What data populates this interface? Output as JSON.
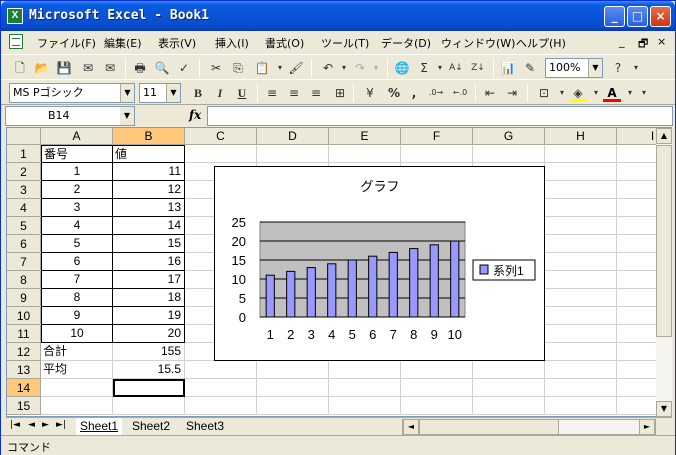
{
  "window": {
    "title": "Microsoft Excel - Book1",
    "app_icon_letter": "X"
  },
  "window_controls": {
    "minimize": "_",
    "maximize": "□",
    "close": "×"
  },
  "menu": [
    "ファイル(F)",
    "編集(E)",
    "表示(V)",
    "挿入(I)",
    "書式(O)",
    "ツール(T)",
    "データ(D)",
    "ウィンドウ(W)",
    "ヘルプ(H)"
  ],
  "doc_controls": {
    "minimize": "_",
    "restore": "🗗",
    "close": "×"
  },
  "toolbar": {
    "zoom": "100%",
    "font_name": "MS Pゴシック",
    "font_size": "11",
    "bold": "B",
    "italic": "I",
    "underline": "U",
    "percent": "%",
    "comma": ","
  },
  "formula_bar": {
    "name_box": "B14",
    "fx": "fx",
    "formula": ""
  },
  "columns": [
    "A",
    "B",
    "C",
    "D",
    "E",
    "F",
    "G",
    "H",
    "I"
  ],
  "rows": [
    "1",
    "2",
    "3",
    "4",
    "5",
    "6",
    "7",
    "8",
    "9",
    "10",
    "11",
    "12",
    "13",
    "14",
    "15"
  ],
  "cells": {
    "a1": "番号",
    "b1": "値",
    "a2": "1",
    "b2": "11",
    "a3": "2",
    "b3": "12",
    "a4": "3",
    "b4": "13",
    "a5": "4",
    "b5": "14",
    "a6": "5",
    "b6": "15",
    "a7": "6",
    "b7": "16",
    "a8": "7",
    "b8": "17",
    "a9": "8",
    "b9": "18",
    "a10": "9",
    "b10": "19",
    "a11": "10",
    "b11": "20",
    "a12": "合計",
    "b12": "155",
    "a13": "平均",
    "b13": "15.5"
  },
  "chart_data": {
    "type": "bar",
    "title": "グラフ",
    "categories": [
      "1",
      "2",
      "3",
      "4",
      "5",
      "6",
      "7",
      "8",
      "9",
      "10"
    ],
    "series": [
      {
        "name": "系列1",
        "values": [
          11,
          12,
          13,
          14,
          15,
          16,
          17,
          18,
          19,
          20
        ],
        "color": "#9999ff"
      }
    ],
    "ylim": [
      0,
      25
    ],
    "yticks": [
      "0",
      "5",
      "10",
      "15",
      "20",
      "25"
    ],
    "grid": true,
    "plot_background": "#c0c0c0",
    "legend_position": "right"
  },
  "sheet_nav": {
    "first": "|◄",
    "prev": "◄",
    "next": "►",
    "last": "►|"
  },
  "scroll": {
    "up": "▲",
    "down": "▼",
    "left": "◄",
    "right": "►"
  },
  "sheets": [
    "Sheet1",
    "Sheet2",
    "Sheet3"
  ],
  "status": "コマンド"
}
